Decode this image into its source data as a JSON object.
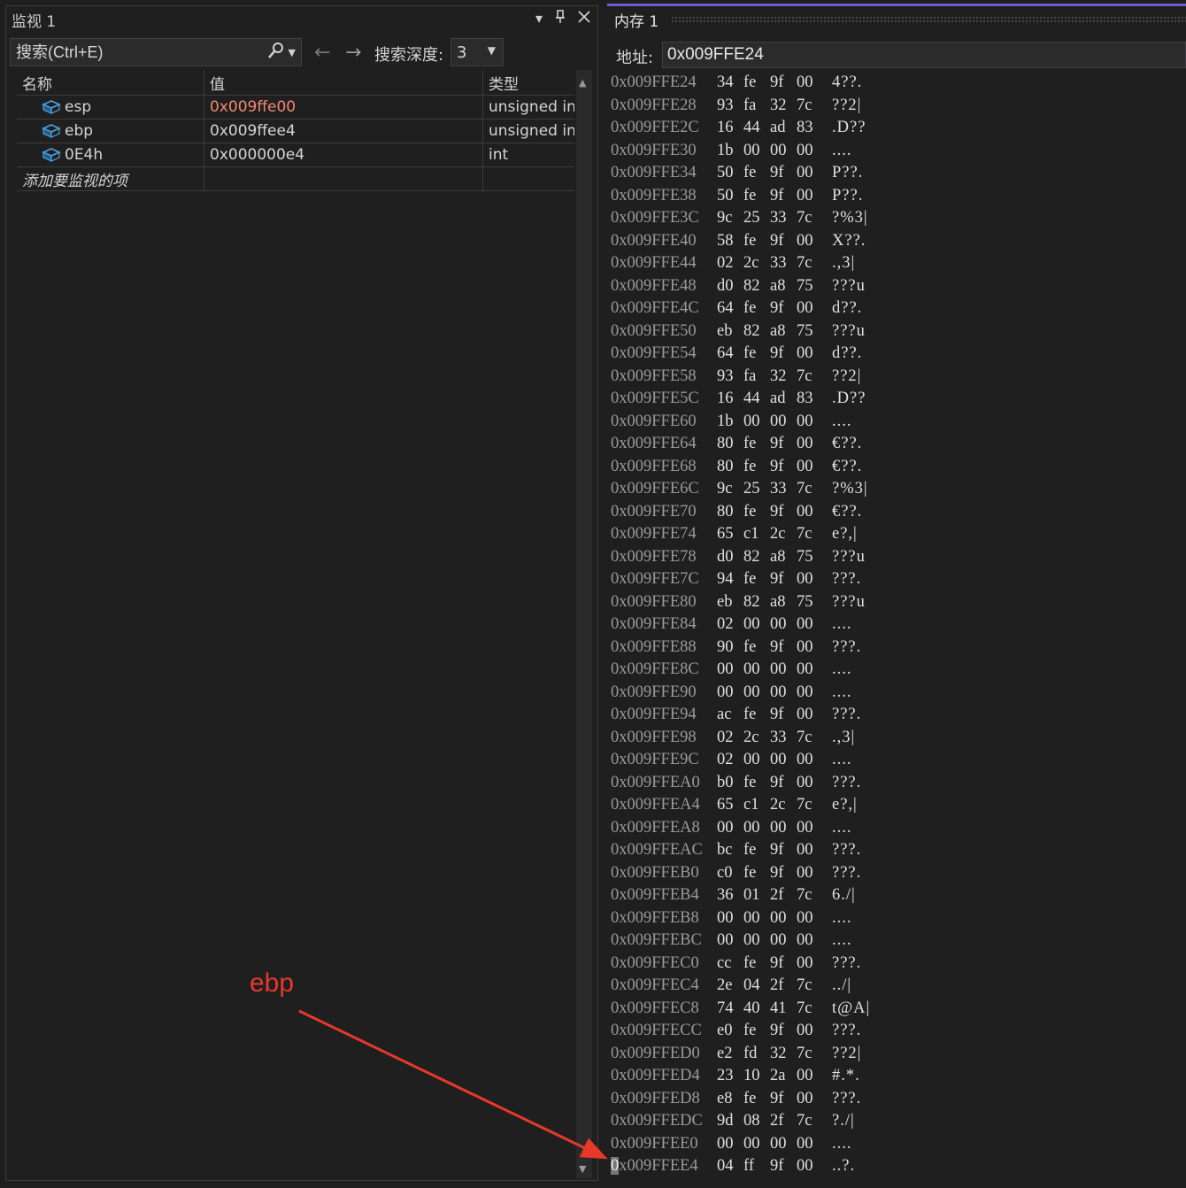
{
  "watch": {
    "title": "监视 1",
    "title_buttons": [
      "▾",
      "📌",
      "✕"
    ],
    "search_placeholder": "搜索(Ctrl+E)",
    "depth_label": "搜索深度:",
    "depth_value": "3",
    "columns": [
      "名称",
      "值",
      "类型"
    ],
    "rows": [
      {
        "name": "esp",
        "value": "0x009ffe00",
        "type": "unsigned int",
        "changed": true
      },
      {
        "name": "ebp",
        "value": "0x009ffee4",
        "type": "unsigned int",
        "changed": false
      },
      {
        "name": "0E4h",
        "value": "0x000000e4",
        "type": "int",
        "changed": false
      }
    ],
    "add_item": "添加要监视的项"
  },
  "memory": {
    "title": "内存 1",
    "address_label": "地址:",
    "address_value": "0x009FFE24",
    "rows": [
      [
        "0x009FFE24",
        "34",
        "fe",
        "9f",
        "00",
        "4??."
      ],
      [
        "0x009FFE28",
        "93",
        "fa",
        "32",
        "7c",
        "??2|"
      ],
      [
        "0x009FFE2C",
        "16",
        "44",
        "ad",
        "83",
        ".D??"
      ],
      [
        "0x009FFE30",
        "1b",
        "00",
        "00",
        "00",
        "...."
      ],
      [
        "0x009FFE34",
        "50",
        "fe",
        "9f",
        "00",
        "P??."
      ],
      [
        "0x009FFE38",
        "50",
        "fe",
        "9f",
        "00",
        "P??."
      ],
      [
        "0x009FFE3C",
        "9c",
        "25",
        "33",
        "7c",
        "?%3|"
      ],
      [
        "0x009FFE40",
        "58",
        "fe",
        "9f",
        "00",
        "X??."
      ],
      [
        "0x009FFE44",
        "02",
        "2c",
        "33",
        "7c",
        ".,3|"
      ],
      [
        "0x009FFE48",
        "d0",
        "82",
        "a8",
        "75",
        "???u"
      ],
      [
        "0x009FFE4C",
        "64",
        "fe",
        "9f",
        "00",
        "d??."
      ],
      [
        "0x009FFE50",
        "eb",
        "82",
        "a8",
        "75",
        "???u"
      ],
      [
        "0x009FFE54",
        "64",
        "fe",
        "9f",
        "00",
        "d??."
      ],
      [
        "0x009FFE58",
        "93",
        "fa",
        "32",
        "7c",
        "??2|"
      ],
      [
        "0x009FFE5C",
        "16",
        "44",
        "ad",
        "83",
        ".D??"
      ],
      [
        "0x009FFE60",
        "1b",
        "00",
        "00",
        "00",
        "...."
      ],
      [
        "0x009FFE64",
        "80",
        "fe",
        "9f",
        "00",
        "€??."
      ],
      [
        "0x009FFE68",
        "80",
        "fe",
        "9f",
        "00",
        "€??."
      ],
      [
        "0x009FFE6C",
        "9c",
        "25",
        "33",
        "7c",
        "?%3|"
      ],
      [
        "0x009FFE70",
        "80",
        "fe",
        "9f",
        "00",
        "€??."
      ],
      [
        "0x009FFE74",
        "65",
        "c1",
        "2c",
        "7c",
        "e?,|"
      ],
      [
        "0x009FFE78",
        "d0",
        "82",
        "a8",
        "75",
        "???u"
      ],
      [
        "0x009FFE7C",
        "94",
        "fe",
        "9f",
        "00",
        "???."
      ],
      [
        "0x009FFE80",
        "eb",
        "82",
        "a8",
        "75",
        "???u"
      ],
      [
        "0x009FFE84",
        "02",
        "00",
        "00",
        "00",
        "...."
      ],
      [
        "0x009FFE88",
        "90",
        "fe",
        "9f",
        "00",
        "???."
      ],
      [
        "0x009FFE8C",
        "00",
        "00",
        "00",
        "00",
        "...."
      ],
      [
        "0x009FFE90",
        "00",
        "00",
        "00",
        "00",
        "...."
      ],
      [
        "0x009FFE94",
        "ac",
        "fe",
        "9f",
        "00",
        "???."
      ],
      [
        "0x009FFE98",
        "02",
        "2c",
        "33",
        "7c",
        ".,3|"
      ],
      [
        "0x009FFE9C",
        "02",
        "00",
        "00",
        "00",
        "...."
      ],
      [
        "0x009FFEA0",
        "b0",
        "fe",
        "9f",
        "00",
        "???."
      ],
      [
        "0x009FFEA4",
        "65",
        "c1",
        "2c",
        "7c",
        "e?,|"
      ],
      [
        "0x009FFEA8",
        "00",
        "00",
        "00",
        "00",
        "...."
      ],
      [
        "0x009FFEAC",
        "bc",
        "fe",
        "9f",
        "00",
        "???."
      ],
      [
        "0x009FFEB0",
        "c0",
        "fe",
        "9f",
        "00",
        "???."
      ],
      [
        "0x009FFEB4",
        "36",
        "01",
        "2f",
        "7c",
        "6./|"
      ],
      [
        "0x009FFEB8",
        "00",
        "00",
        "00",
        "00",
        "...."
      ],
      [
        "0x009FFEBC",
        "00",
        "00",
        "00",
        "00",
        "...."
      ],
      [
        "0x009FFEC0",
        "cc",
        "fe",
        "9f",
        "00",
        "???."
      ],
      [
        "0x009FFEC4",
        "2e",
        "04",
        "2f",
        "7c",
        "../|"
      ],
      [
        "0x009FFEC8",
        "74",
        "40",
        "41",
        "7c",
        "t@A|"
      ],
      [
        "0x009FFECC",
        "e0",
        "fe",
        "9f",
        "00",
        "???."
      ],
      [
        "0x009FFED0",
        "e2",
        "fd",
        "32",
        "7c",
        "??2|"
      ],
      [
        "0x009FFED4",
        "23",
        "10",
        "2a",
        "00",
        "#.*."
      ],
      [
        "0x009FFED8",
        "e8",
        "fe",
        "9f",
        "00",
        "???."
      ],
      [
        "0x009FFEDC",
        "9d",
        "08",
        "2f",
        "7c",
        "?./|"
      ],
      [
        "0x009FFEE0",
        "00",
        "00",
        "00",
        "00",
        "...."
      ],
      [
        "0x009FFEE4",
        "04",
        "ff",
        "9f",
        "00",
        "..?."
      ]
    ]
  },
  "annotation": {
    "label": "ebp",
    "color": "#e8382a"
  },
  "colors": {
    "changed_value": "#f48771",
    "memory_accent": "#6b5fd4"
  }
}
